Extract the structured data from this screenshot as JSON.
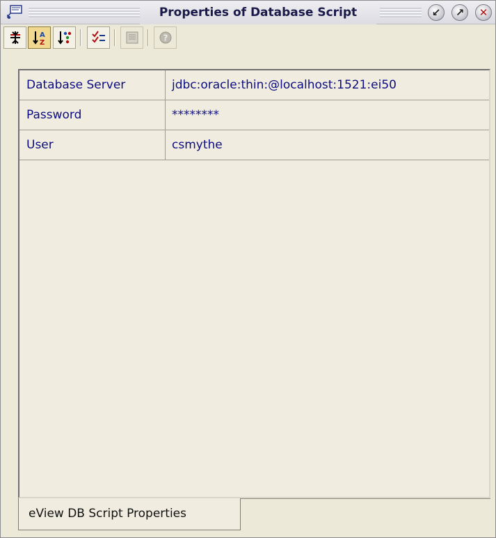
{
  "window": {
    "title": "Properties of Database Script",
    "buttons": [
      {
        "name": "minimize",
        "glyph": "↙"
      },
      {
        "name": "maximize",
        "glyph": "↗"
      },
      {
        "name": "close",
        "glyph": "✕"
      }
    ]
  },
  "toolbar": {
    "tools": [
      {
        "name": "categorized",
        "icon": "categorized-icon",
        "state": "normal"
      },
      {
        "name": "sort-by-name",
        "icon": "sort-az-icon",
        "state": "selected"
      },
      {
        "name": "sort-by-type",
        "icon": "sort-type-icon",
        "state": "normal"
      },
      {
        "name": "show-editable",
        "icon": "checklist-icon",
        "state": "normal"
      },
      {
        "name": "description",
        "icon": "description-icon",
        "state": "disabled"
      },
      {
        "name": "help",
        "icon": "help-icon",
        "state": "disabled"
      }
    ]
  },
  "properties": [
    {
      "name": "Database Server",
      "value": "jdbc:oracle:thin:@localhost:1521:ei50"
    },
    {
      "name": "Password",
      "value": "********"
    },
    {
      "name": "User",
      "value": "csmythe"
    }
  ],
  "tabs": [
    {
      "label": "eView DB Script Properties",
      "active": true
    }
  ],
  "colors": {
    "background": "#ece9d8",
    "text": "#0c0c80",
    "selected_tool": "#f0d890"
  }
}
